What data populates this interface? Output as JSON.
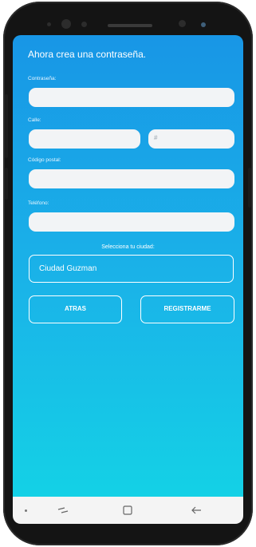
{
  "form": {
    "title": "Ahora crea una contraseña.",
    "password_label": "Contraseña:",
    "street_label": "Calle:",
    "number_placeholder": "#",
    "postal_label": "Código postal:",
    "phone_label": "Teléfono:",
    "city_prompt": "Selecciona tu ciudad:",
    "city_value": "Ciudad Guzman"
  },
  "buttons": {
    "back": "ATRAS",
    "register": "REGISTRARME"
  },
  "icons": {
    "nav_dot": "dot-icon",
    "recent": "recent-apps-icon",
    "home": "home-icon",
    "back": "back-arrow-icon"
  },
  "colors": {
    "gradient_top": "#1896e6",
    "gradient_bottom": "#14d1e6",
    "field_bg": "#f2f4f6"
  }
}
